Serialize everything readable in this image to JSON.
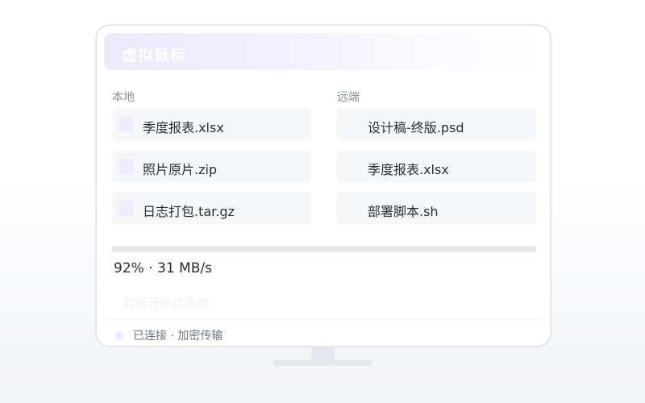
{
  "app": {
    "title": "虚拟鼠标"
  },
  "local": {
    "header": "本地",
    "files": [
      {
        "name": "季度报表.xlsx",
        "icon": "file-icon"
      },
      {
        "name": "照片原片.zip",
        "icon": "file-icon"
      },
      {
        "name": "日志打包.tar.gz",
        "icon": "file-icon"
      }
    ]
  },
  "remote": {
    "header": "远端",
    "files": [
      {
        "name": "设计稿-终版.psd"
      },
      {
        "name": "季度报表.xlsx"
      },
      {
        "name": "部署脚本.sh"
      }
    ]
  },
  "transfer": {
    "progress_percent": 92,
    "text": "92% · 31 MB/s"
  },
  "autostart": {
    "label": "勾选开机自启动"
  },
  "status": {
    "text": "已连接 · 加密传输"
  },
  "colors": {
    "accent": "#ece9fb",
    "file_icon": "#f0ecfc",
    "status_dot": "#eeeafc"
  }
}
